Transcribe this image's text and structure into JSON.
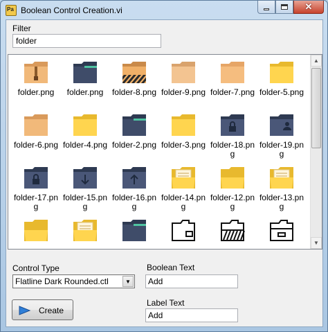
{
  "window": {
    "title": "Boolean Control Creation.vi"
  },
  "filter": {
    "label": "Filter",
    "value": "folder"
  },
  "tiles": [
    {
      "label": "folder.png",
      "icon": "folder-zip-icon"
    },
    {
      "label": "folder.png",
      "icon": "folder-dark-icon"
    },
    {
      "label": "folder-8.png",
      "icon": "folder-caution-icon"
    },
    {
      "label": "folder-9.png",
      "icon": "folder-light-tan-icon"
    },
    {
      "label": "folder-7.png",
      "icon": "folder-peach-icon"
    },
    {
      "label": "folder-5.png",
      "icon": "folder-yellow-icon"
    },
    {
      "label": "folder-6.png",
      "icon": "folder-tan-icon"
    },
    {
      "label": "folder-4.png",
      "icon": "folder-yellow-icon"
    },
    {
      "label": "folder-2.png",
      "icon": "folder-dark-icon"
    },
    {
      "label": "folder-3.png",
      "icon": "folder-yellow-icon"
    },
    {
      "label": "folder-18.png",
      "icon": "folder-lock-icon"
    },
    {
      "label": "folder-19.png",
      "icon": "folder-person-icon"
    },
    {
      "label": "folder-17.png",
      "icon": "folder-lock-icon"
    },
    {
      "label": "folder-15.png",
      "icon": "folder-download-icon"
    },
    {
      "label": "folder-16.png",
      "icon": "folder-upload-icon"
    },
    {
      "label": "folder-14.png",
      "icon": "folder-documents-icon"
    },
    {
      "label": "folder-12.png",
      "icon": "folder-open-icon"
    },
    {
      "label": "folder-13.png",
      "icon": "folder-documents-icon"
    },
    {
      "label": "",
      "icon": "folder-open-icon"
    },
    {
      "label": "",
      "icon": "folder-documents-icon"
    },
    {
      "label": "",
      "icon": "folder-dark-icon"
    },
    {
      "label": "",
      "icon": "folder-outline-icon"
    },
    {
      "label": "",
      "icon": "folder-outline-striped-icon"
    },
    {
      "label": "",
      "icon": "folder-outline-drawer-icon"
    }
  ],
  "controlType": {
    "label": "Control Type",
    "value": "Flatline Dark Rounded.ctl"
  },
  "booleanText": {
    "label": "Boolean Text",
    "value": "Add"
  },
  "labelText": {
    "label": "Label Text",
    "value": "Add"
  },
  "create": {
    "label": "Create"
  }
}
